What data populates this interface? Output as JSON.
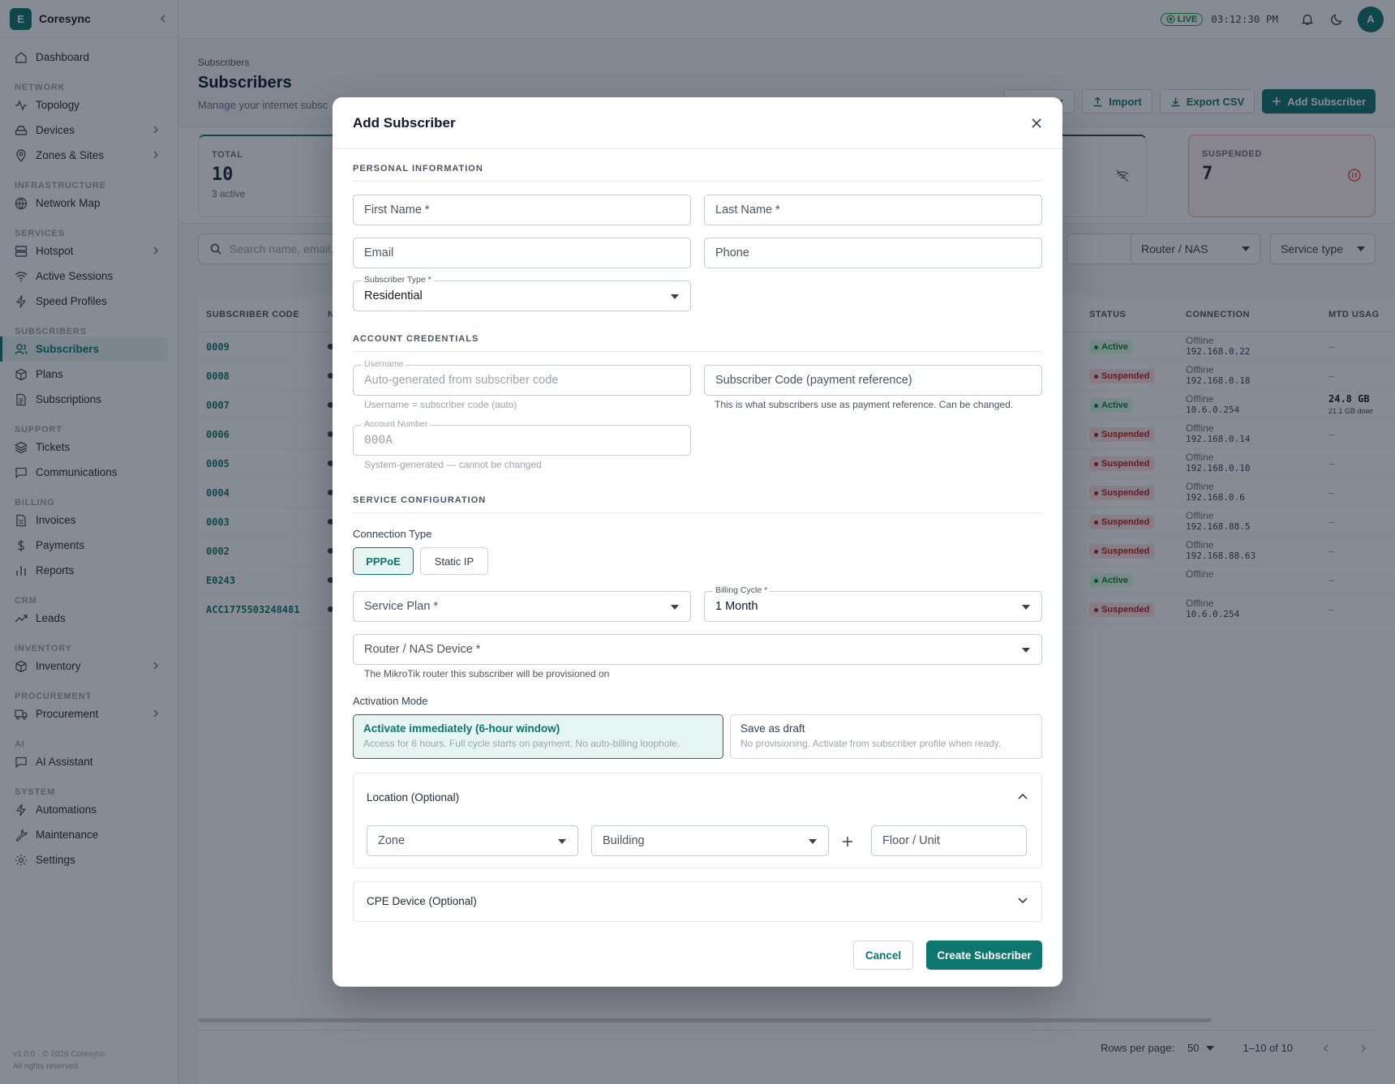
{
  "brand": {
    "initial": "E",
    "name": "Coresync"
  },
  "sidebar": {
    "items": [
      {
        "label": "Dashboard"
      },
      {
        "section": "NETWORK"
      },
      {
        "label": "Topology"
      },
      {
        "label": "Devices"
      },
      {
        "label": "Zones & Sites"
      },
      {
        "section": "INFRASTRUCTURE"
      },
      {
        "label": "Network Map"
      },
      {
        "section": "SERVICES"
      },
      {
        "label": "Hotspot"
      },
      {
        "label": "Active Sessions"
      },
      {
        "label": "Speed Profiles"
      },
      {
        "section": "SUBSCRIBERS"
      },
      {
        "label": "Subscribers"
      },
      {
        "label": "Plans"
      },
      {
        "label": "Subscriptions"
      },
      {
        "section": "SUPPORT"
      },
      {
        "label": "Tickets"
      },
      {
        "label": "Communications"
      },
      {
        "section": "BILLING"
      },
      {
        "label": "Invoices"
      },
      {
        "label": "Payments"
      },
      {
        "label": "Reports"
      },
      {
        "section": "CRM"
      },
      {
        "label": "Leads"
      },
      {
        "section": "INVENTORY"
      },
      {
        "label": "Inventory"
      },
      {
        "section": "PROCUREMENT"
      },
      {
        "label": "Procurement"
      },
      {
        "section": "AI"
      },
      {
        "label": "AI Assistant"
      },
      {
        "section": "SYSTEM"
      },
      {
        "label": "Automations"
      },
      {
        "label": "Maintenance"
      },
      {
        "label": "Settings"
      }
    ],
    "footer_version": "v1.0.0 · © 2026 Coresync",
    "footer_rights": "All rights reserved"
  },
  "topbar": {
    "live": "LIVE",
    "clock": "03:12:30 PM",
    "avatar": "A"
  },
  "page": {
    "breadcrumb": "Subscribers",
    "title": "Subscribers",
    "subtitle": "Manage your internet subsc",
    "import": "Import",
    "export": "Export CSV",
    "add": "Add Subscriber"
  },
  "stats": {
    "total_label": "TOTAL",
    "total_value": "10",
    "total_sub": "3 active",
    "suspended_label": "SUSPENDED",
    "suspended_value": "7"
  },
  "filters": {
    "search": "Search name, email,",
    "router": "Router / NAS",
    "service": "Service type"
  },
  "table": {
    "headers": {
      "code": "SUBSCRIBER CODE",
      "n": "N",
      "status": "STATUS",
      "connection": "CONNECTION",
      "mtd": "MTD USAG"
    },
    "rows": [
      {
        "code": "0009",
        "status": "Active",
        "conn": "Offline",
        "ip": "192.168.0.22",
        "mtd": "—"
      },
      {
        "code": "0008",
        "status": "Suspended",
        "conn": "Offline",
        "ip": "192.168.0.18",
        "mtd": "—"
      },
      {
        "code": "0007",
        "status": "Active",
        "conn": "Offline",
        "ip": "10.6.0.254",
        "mtd": "24.8 GB"
      },
      {
        "code": "0006",
        "status": "Suspended",
        "conn": "Offline",
        "ip": "192.168.0.14",
        "mtd": "—"
      },
      {
        "code": "0005",
        "status": "Suspended",
        "conn": "Offline",
        "ip": "192.168.0.10",
        "mtd": "—"
      },
      {
        "code": "0004",
        "status": "Suspended",
        "conn": "Offline",
        "ip": "192.168.0.6",
        "mtd": "—"
      },
      {
        "code": "0003",
        "status": "Suspended",
        "conn": "Offline",
        "ip": "192.168.88.5",
        "mtd": "—"
      },
      {
        "code": "0002",
        "status": "Suspended",
        "conn": "Offline",
        "ip": "192.168.88.63",
        "mtd": "—"
      },
      {
        "code": "E0243",
        "status": "Active",
        "conn": "Offline",
        "ip": "",
        "mtd": "—"
      },
      {
        "code": "ACC1775503248481",
        "status": "Suspended",
        "conn": "Offline",
        "ip": "10.6.0.254",
        "mtd": "—"
      }
    ],
    "mtd_sub": "21.1 GB dowr"
  },
  "pager": {
    "rows_label": "Rows per page:",
    "rows_value": "50",
    "range": "1–10 of 10"
  },
  "modal": {
    "title": "Add Subscriber",
    "personal": "PERSONAL INFORMATION",
    "first_name": "First Name *",
    "last_name": "Last Name *",
    "email": "Email",
    "phone": "Phone",
    "sub_type_label": "Subscriber Type *",
    "sub_type_value": "Residential",
    "account": "ACCOUNT CREDENTIALS",
    "username_label": "Username",
    "username_placeholder": "Auto-generated from subscriber code",
    "username_help": "Username = subscriber code (auto)",
    "sub_code": "Subscriber Code (payment reference)",
    "sub_code_help": "This is what subscribers use as payment reference. Can be changed.",
    "acct_label": "Account Number",
    "acct_value": "000A",
    "acct_help": "System-generated — cannot be changed",
    "service": "SERVICE CONFIGURATION",
    "conn_type_label": "Connection Type",
    "conn_pppoe": "PPPoE",
    "conn_static": "Static IP",
    "service_plan": "Service Plan *",
    "billing_label": "Billing Cycle *",
    "billing_value": "1 Month",
    "router": "Router / NAS Device *",
    "router_help": "The MikroTik router this subscriber will be provisioned on",
    "activation_label": "Activation Mode",
    "act_now_title": "Activate immediately (6-hour window)",
    "act_now_desc": "Access for 6 hours. Full cycle starts on payment. No auto-billing loophole.",
    "act_draft_title": "Save as draft",
    "act_draft_desc": "No provisioning. Activate from subscriber profile when ready.",
    "location": "Location (Optional)",
    "zone": "Zone",
    "building": "Building",
    "floor": "Floor / Unit",
    "cpe": "CPE Device (Optional)",
    "cancel": "Cancel",
    "create": "Create Subscriber"
  }
}
